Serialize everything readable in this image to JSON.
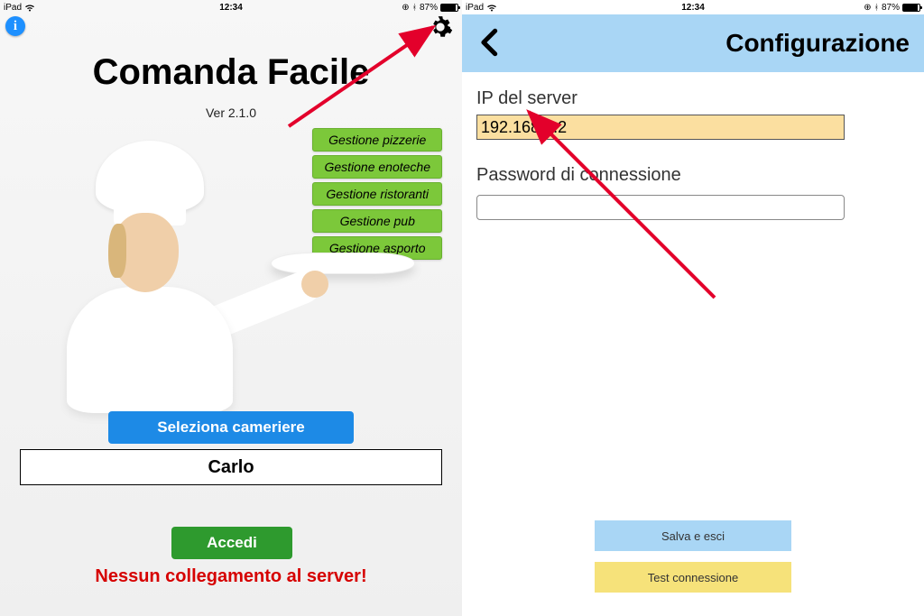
{
  "status": {
    "device": "iPad",
    "time": "12:34",
    "battery_pct": "87%"
  },
  "left": {
    "title": "Comanda Facile",
    "version": "Ver 2.1.0",
    "features": [
      "Gestione pizzerie",
      "Gestione enoteche",
      "Gestione ristoranti",
      "Gestione pub",
      "Gestione asporto"
    ],
    "select_waiter_btn": "Seleziona cameriere",
    "waiter_name": "Carlo",
    "login_btn": "Accedi",
    "error": "Nessun collegamento al server!"
  },
  "right": {
    "nav_title": "Configurazione",
    "ip_label": "IP del server",
    "ip_value": "192.168.0.2",
    "pw_label": "Password di connessione",
    "pw_value": "",
    "save_btn": "Salva e esci",
    "test_btn": "Test connessione"
  },
  "colors": {
    "feature_bg": "#7cc83a",
    "btn_blue": "#1d8ae6",
    "btn_green": "#2e9a2e",
    "navbar": "#a9d6f5",
    "ip_highlight": "#fbdfa0",
    "soft_yellow": "#f6e27a",
    "error": "#d60000",
    "arrow": "#e3002b"
  }
}
